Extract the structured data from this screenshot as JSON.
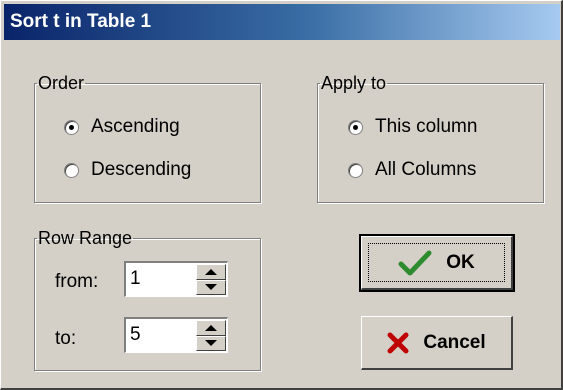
{
  "window": {
    "title": "Sort t in Table 1"
  },
  "order": {
    "legend": "Order",
    "options": [
      {
        "label": "Ascending",
        "checked": true
      },
      {
        "label": "Descending",
        "checked": false
      }
    ]
  },
  "apply_to": {
    "legend": "Apply to",
    "options": [
      {
        "label": "This column",
        "checked": true
      },
      {
        "label": "All Columns",
        "checked": false
      }
    ]
  },
  "row_range": {
    "legend": "Row Range",
    "from_label": "from:",
    "from_value": "1",
    "to_label": "to:",
    "to_value": "5"
  },
  "buttons": {
    "ok_label": "OK",
    "cancel_label": "Cancel",
    "ok_icon": "checkmark-icon",
    "cancel_icon": "x-icon"
  },
  "colors": {
    "title_gradient_start": "#0a246a",
    "title_gradient_end": "#a6caf0",
    "dialog_bg": "#d4d0c8",
    "check_green": "#2e8b2e",
    "x_red": "#c00000"
  }
}
